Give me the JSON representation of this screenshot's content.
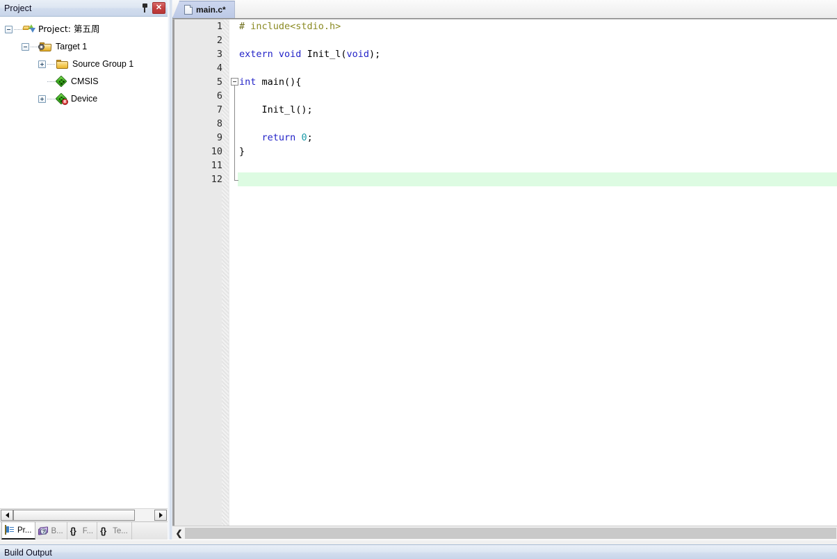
{
  "project_panel": {
    "title": "Project",
    "pin_icon": "pin-icon",
    "close_label": "✕",
    "tree": [
      {
        "label": "Project: 第五周",
        "icon": "project-icon",
        "expander": "minus",
        "depth": 0,
        "cjk": true
      },
      {
        "label": "Target 1",
        "icon": "folder-target-icon",
        "expander": "minus",
        "depth": 1,
        "cjk": false
      },
      {
        "label": "Source Group 1",
        "icon": "folder-icon",
        "expander": "plus",
        "depth": 2,
        "cjk": false
      },
      {
        "label": "CMSIS",
        "icon": "component-diamond-icon",
        "expander": "none",
        "depth": 2,
        "cjk": false
      },
      {
        "label": "Device",
        "icon": "component-diamond-warning-icon",
        "expander": "plus",
        "depth": 2,
        "cjk": false
      }
    ],
    "device_badge": "x",
    "scrollbar": {
      "left_arrow": "◀",
      "right_arrow": "▶"
    },
    "tabs": [
      {
        "label": "Pr...",
        "icon": "project-window-icon",
        "active": true
      },
      {
        "label": "B...",
        "icon": "books-icon",
        "active": false
      },
      {
        "label": "F...",
        "icon": "braces-icon",
        "icon_text": "{}",
        "active": false
      },
      {
        "label": "Te...",
        "icon": "functions-icon",
        "icon_text": "{}",
        "active": false
      }
    ]
  },
  "editor": {
    "tabs": [
      {
        "label": "main.c*",
        "icon": "document-icon",
        "active": true
      }
    ],
    "scrollbar": {
      "left_chevron": "❮"
    },
    "lines": [
      {
        "number": "1",
        "fold": "none",
        "current": false,
        "tokens": [
          {
            "text": "#",
            "cls": "tk-hash"
          },
          {
            "text": " include<stdio.h>",
            "cls": "tk-pre"
          }
        ]
      },
      {
        "number": "2",
        "fold": "none",
        "current": false,
        "tokens": []
      },
      {
        "number": "3",
        "fold": "none",
        "current": false,
        "tokens": [
          {
            "text": "extern",
            "cls": "tk-kw"
          },
          {
            "text": " ",
            "cls": "tk-plain"
          },
          {
            "text": "void",
            "cls": "tk-kw"
          },
          {
            "text": " Init_l(",
            "cls": "tk-plain"
          },
          {
            "text": "void",
            "cls": "tk-kw"
          },
          {
            "text": ");",
            "cls": "tk-plain"
          }
        ]
      },
      {
        "number": "4",
        "fold": "none",
        "current": false,
        "tokens": []
      },
      {
        "number": "5",
        "fold": "box",
        "current": false,
        "tokens": [
          {
            "text": "int",
            "cls": "tk-kw"
          },
          {
            "text": " main(){",
            "cls": "tk-plain"
          }
        ]
      },
      {
        "number": "6",
        "fold": "line",
        "current": false,
        "tokens": []
      },
      {
        "number": "7",
        "fold": "line",
        "current": false,
        "tokens": [
          {
            "text": "    Init_l();",
            "cls": "tk-plain"
          }
        ]
      },
      {
        "number": "8",
        "fold": "line",
        "current": false,
        "tokens": []
      },
      {
        "number": "9",
        "fold": "line",
        "current": false,
        "tokens": [
          {
            "text": "    ",
            "cls": "tk-plain"
          },
          {
            "text": "return",
            "cls": "tk-kw"
          },
          {
            "text": " ",
            "cls": "tk-plain"
          },
          {
            "text": "0",
            "cls": "tk-num"
          },
          {
            "text": ";",
            "cls": "tk-plain"
          }
        ]
      },
      {
        "number": "10",
        "fold": "line",
        "current": false,
        "tokens": [
          {
            "text": "}",
            "cls": "tk-plain"
          }
        ]
      },
      {
        "number": "11",
        "fold": "line",
        "current": false,
        "tokens": []
      },
      {
        "number": "12",
        "fold": "end",
        "current": true,
        "tokens": []
      }
    ]
  },
  "build_output": {
    "title": "Build Output"
  },
  "colors": {
    "current_line_highlight": "#ddfbe2",
    "keyword": "#2323c8",
    "preprocessor": "#8a8a22",
    "number": "#1b9ba8",
    "gutter_bg": "#e9e9e9",
    "tab_active_bg": "#c3cfea",
    "titlebar_bg": "#d2ddee"
  }
}
